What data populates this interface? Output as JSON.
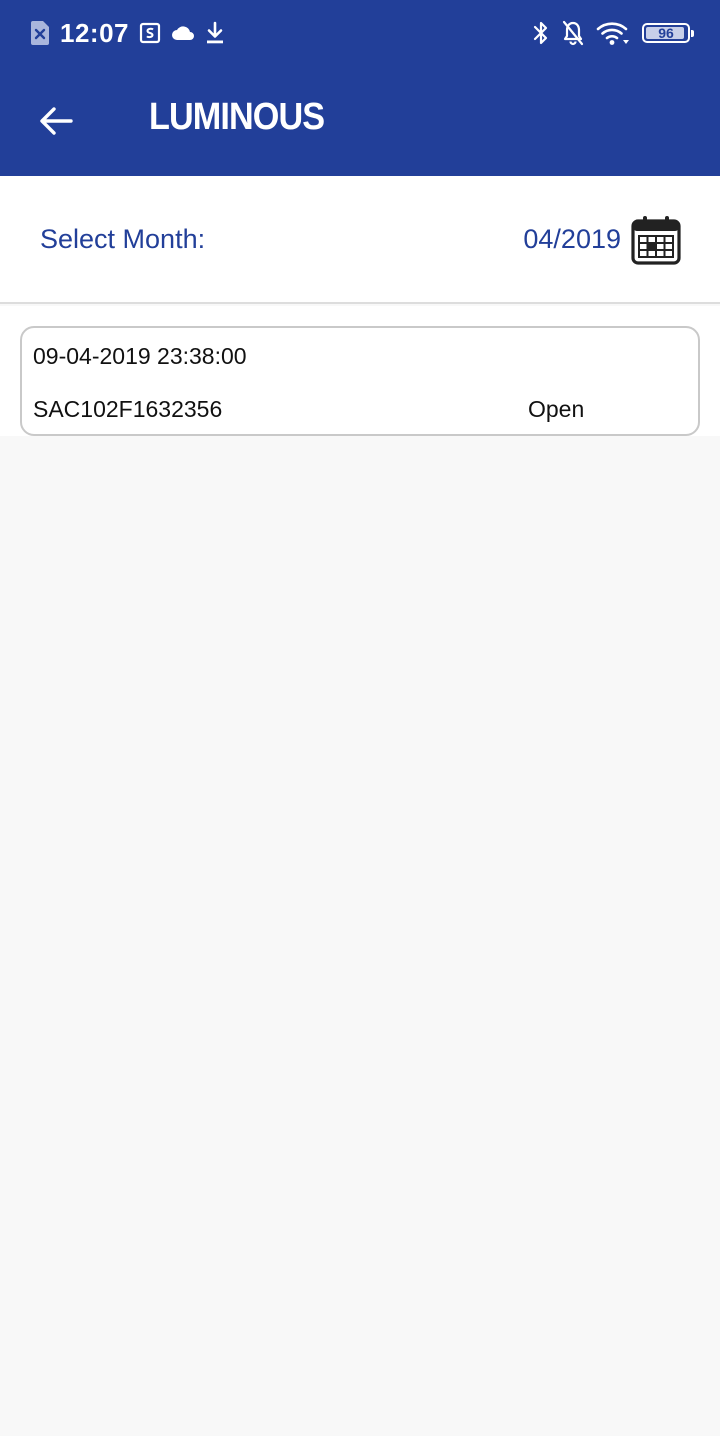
{
  "status_bar": {
    "time": "12:07",
    "battery_level": "96",
    "battery_fraction": 0.96,
    "left_icons": [
      "sim-error-icon",
      "screenshot-icon",
      "cloud-icon",
      "download-icon"
    ],
    "right_icons": [
      "bluetooth-icon",
      "notifications-off-icon",
      "wifi-icon",
      "battery-icon"
    ]
  },
  "toolbar": {
    "back_icon": "arrow-left-icon",
    "brand": "LUMINOUS"
  },
  "month_selector": {
    "label": "Select Month:",
    "value": "04/2019",
    "icon": "calendar-icon"
  },
  "records": [
    {
      "datetime": "09-04-2019 23:38:00",
      "serial": "SAC102F1632356",
      "status": "Open"
    }
  ],
  "colors": {
    "brand_blue": "#223f99",
    "background": "#f8f8f8",
    "card_border": "#c9c9c9"
  }
}
